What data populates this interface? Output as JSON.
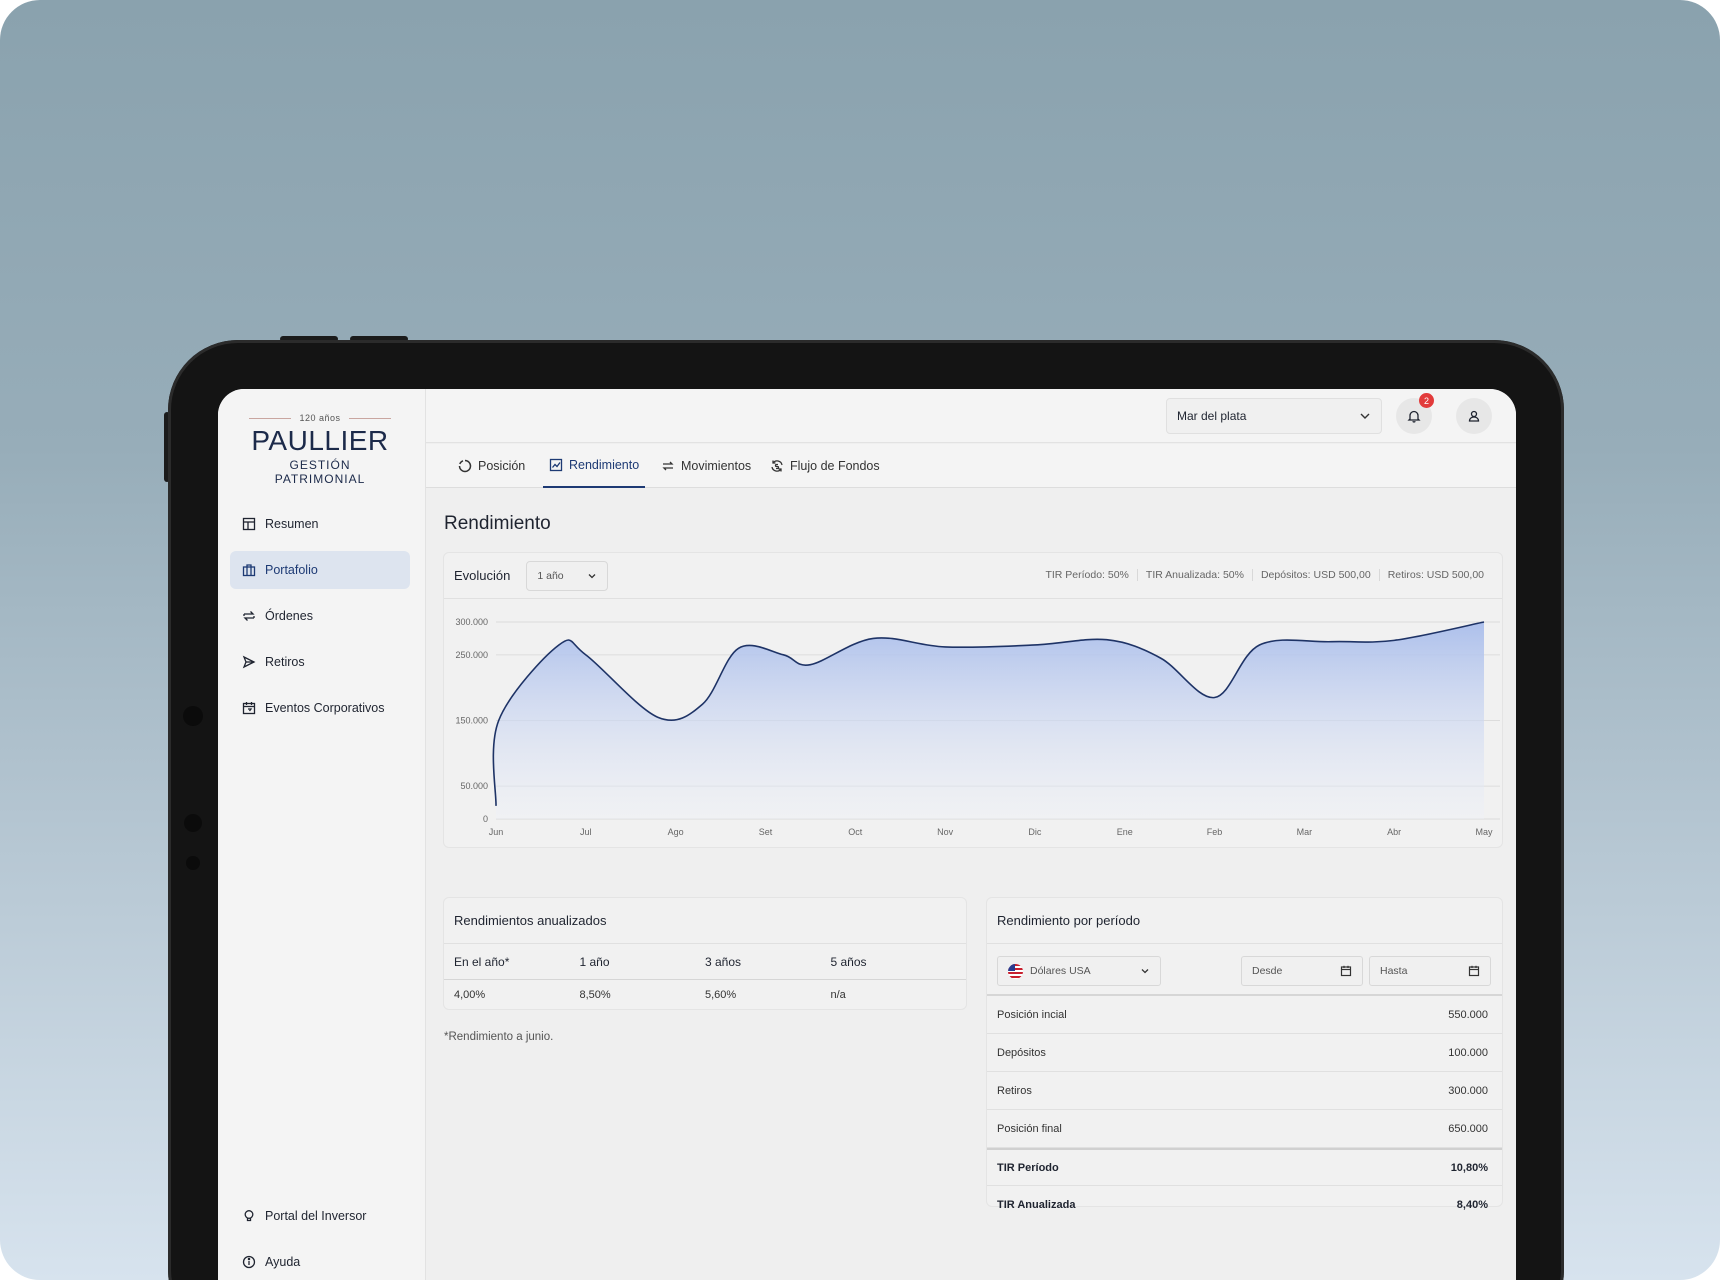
{
  "brand": {
    "years": "120 años",
    "name": "PAULLIER",
    "subtitle": "GESTIÓN PATRIMONIAL"
  },
  "sidebar": {
    "items": [
      {
        "label": "Resumen",
        "icon": "layout-icon"
      },
      {
        "label": "Portafolio",
        "icon": "briefcase-icon",
        "active": true
      },
      {
        "label": "Órdenes",
        "icon": "swap-icon"
      },
      {
        "label": "Retiros",
        "icon": "send-icon"
      },
      {
        "label": "Eventos Corporativos",
        "icon": "calendar-icon"
      }
    ],
    "bottom": [
      {
        "label": "Portal del Inversor",
        "icon": "lightbulb-icon"
      },
      {
        "label": "Ayuda",
        "icon": "info-icon"
      }
    ]
  },
  "topbar": {
    "branch": "Mar del plata",
    "notifications": "2"
  },
  "tabs": [
    {
      "label": "Posición",
      "icon": "donut-icon"
    },
    {
      "label": "Rendimiento",
      "icon": "chart-icon",
      "active": true
    },
    {
      "label": "Movimientos",
      "icon": "arrows-icon"
    },
    {
      "label": "Flujo de Fondos",
      "icon": "refresh-dollar-icon"
    }
  ],
  "page": {
    "title": "Rendimiento"
  },
  "evolution": {
    "title": "Evolución",
    "period": "1 año",
    "stats": [
      "TIR Período: 50%",
      "TIR Anualizada: 50%",
      "Depósitos: USD 500,00",
      "Retiros: USD 500,00"
    ]
  },
  "chart_data": {
    "type": "area",
    "categories": [
      "Jun",
      "Jul",
      "Ago",
      "Set",
      "Oct",
      "Nov",
      "Dic",
      "Ene",
      "Feb",
      "Mar",
      "Abr",
      "May"
    ],
    "x": [
      0,
      0.03,
      0.7,
      1.0,
      1.8,
      2.3,
      2.7,
      3.2,
      3.5,
      4.2,
      5.0,
      6.0,
      6.8,
      7.4,
      8.0,
      8.5,
      9.3,
      10.0,
      11.0
    ],
    "values": [
      20000,
      150000,
      265000,
      250000,
      155000,
      175000,
      260000,
      250000,
      235000,
      275000,
      262000,
      265000,
      273000,
      245000,
      185000,
      265000,
      270000,
      272000,
      300000
    ],
    "yticks": [
      "300.000",
      "250.000",
      "150.000",
      "50.000",
      "0"
    ],
    "ylim": [
      0,
      300000
    ],
    "colors": {
      "line": "#1e3366",
      "fill_top": "#a9bdeb",
      "fill_bottom": "#eef1f8"
    },
    "grid": true
  },
  "annual": {
    "title": "Rendimientos anualizados",
    "headers": [
      "En el año*",
      "1 año",
      "3 años",
      "5 años"
    ],
    "values": [
      "4,00%",
      "8,50%",
      "5,60%",
      "n/a"
    ],
    "note": "*Rendimiento a junio."
  },
  "period_perf": {
    "title": "Rendimiento por período",
    "currency": "Dólares USA",
    "from_placeholder": "Desde",
    "to_placeholder": "Hasta",
    "rows": [
      {
        "label": "Posición incial",
        "value": "550.000"
      },
      {
        "label": "Depósitos",
        "value": "100.000"
      },
      {
        "label": "Retiros",
        "value": "300.000"
      },
      {
        "label": "Posición final",
        "value": "650.000"
      },
      {
        "label": "TIR Período",
        "value": "10,80%",
        "bold": true
      },
      {
        "label": "TIR Anualizada",
        "value": "8,40%",
        "bold": true
      }
    ]
  }
}
